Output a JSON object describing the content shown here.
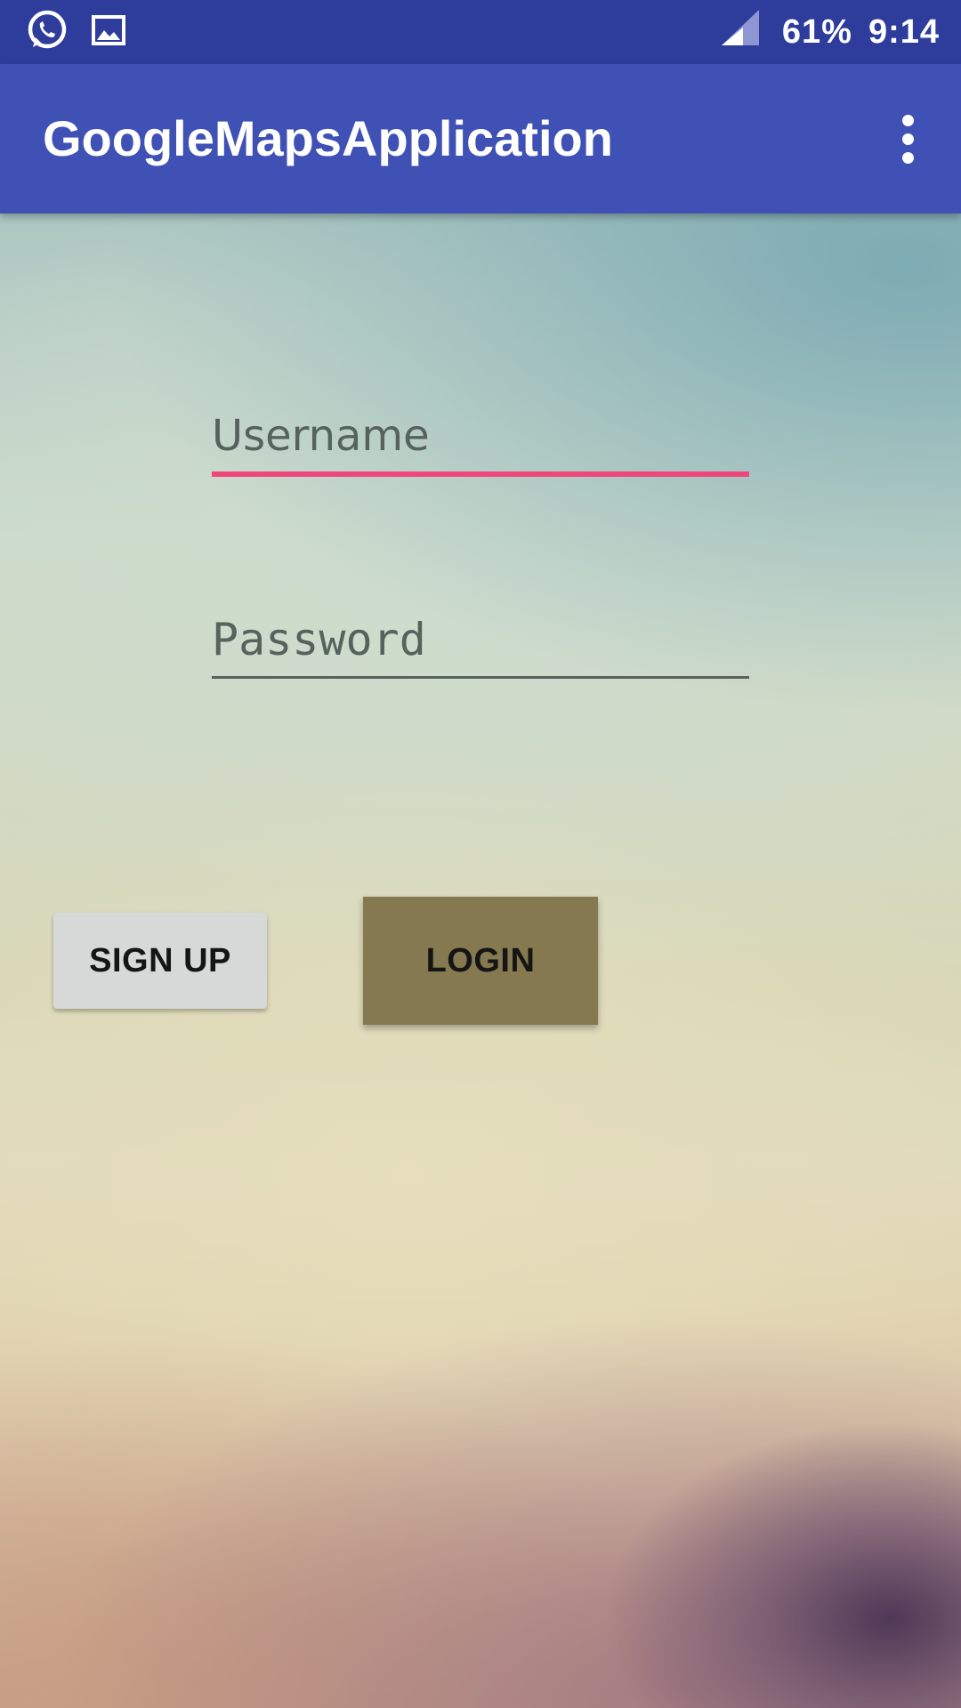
{
  "status_bar": {
    "left_icons": [
      "whatsapp-icon",
      "image-icon"
    ],
    "signal_icon": "signal-icon",
    "battery": "61%",
    "time": "9:14"
  },
  "app_bar": {
    "title": "GoogleMapsApplication",
    "overflow_icon": "more-vert-icon"
  },
  "form": {
    "username": {
      "value": "",
      "placeholder": "Username",
      "focused": true
    },
    "password": {
      "value": "",
      "placeholder": "Password"
    }
  },
  "buttons": {
    "signup_label": "SIGN UP",
    "login_label": "LOGIN"
  },
  "colors": {
    "status_bar": "#2e3d9c",
    "app_bar": "#3f51b5",
    "accent": "#f1467b",
    "login_button": "#84794f",
    "signup_button": "#d7d8d8"
  }
}
